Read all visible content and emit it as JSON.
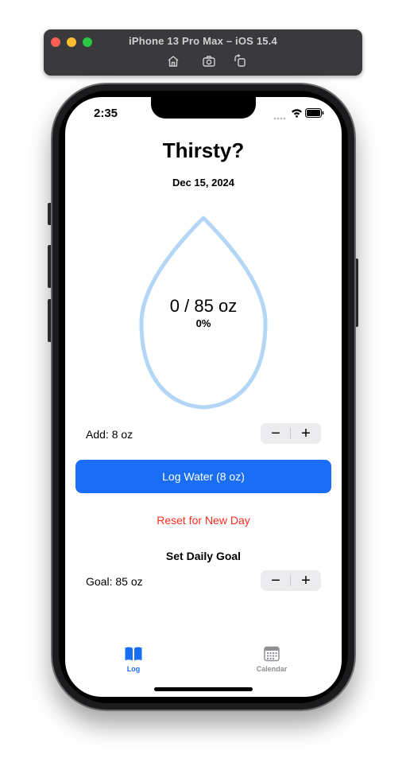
{
  "simulator": {
    "title": "iPhone 13 Pro Max – iOS 15.4",
    "tools": [
      "home-icon",
      "screenshot-icon",
      "rotate-icon"
    ]
  },
  "status": {
    "time": "2:35"
  },
  "header": {
    "title": "Thirsty?",
    "date": "Dec 15, 2024"
  },
  "progress": {
    "amount_text": "0 / 85 oz",
    "percent_text": "0%",
    "fraction": 0
  },
  "add": {
    "label": "Add: 8 oz",
    "minus": "−",
    "plus": "+"
  },
  "log_button": "Log Water (8 oz)",
  "reset_label": "Reset for New Day",
  "goal": {
    "heading": "Set Daily Goal",
    "label": "Goal: 85 oz",
    "minus": "−",
    "plus": "+"
  },
  "tabs": [
    {
      "label": "Log",
      "icon": "book-icon",
      "active": true
    },
    {
      "label": "Calendar",
      "icon": "calendar-icon",
      "active": false
    }
  ],
  "colors": {
    "accent": "#1a6ef5",
    "drop_outline": "#b3d6f7",
    "reset": "#ff2d20",
    "tab_inactive": "#8e8e93"
  }
}
